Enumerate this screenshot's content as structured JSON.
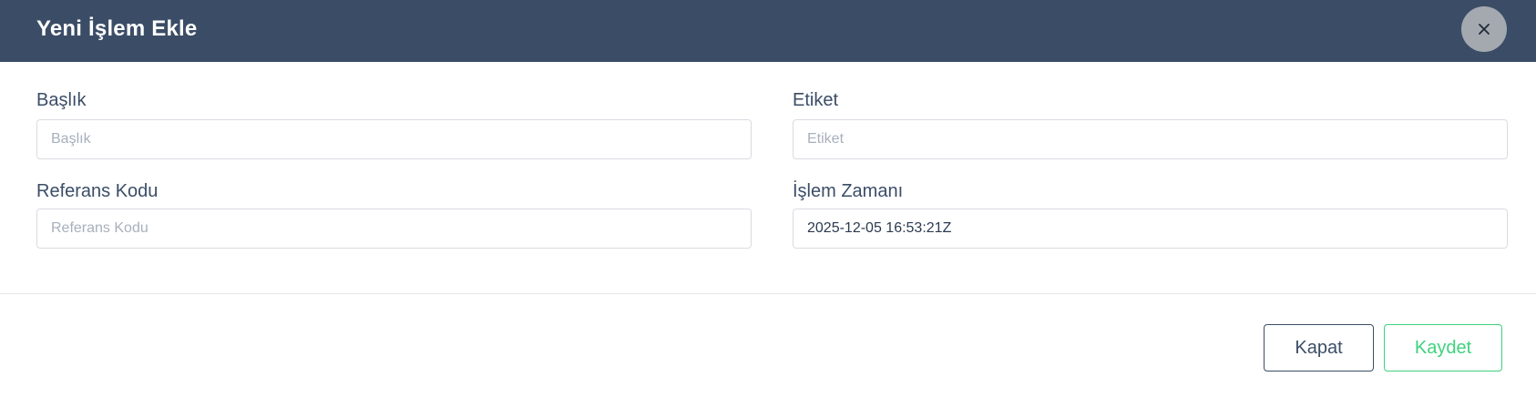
{
  "modal": {
    "title": "Yeni İşlem Ekle",
    "close_icon": "close-icon"
  },
  "form": {
    "title_field": {
      "label": "Başlık",
      "placeholder": "Başlık",
      "value": ""
    },
    "tag_field": {
      "label": "Etiket",
      "placeholder": "Etiket",
      "value": ""
    },
    "reference_field": {
      "label": "Referans Kodu",
      "placeholder": "Referans Kodu",
      "value": ""
    },
    "time_field": {
      "label": "İşlem Zamanı",
      "placeholder": "",
      "value": "2025-12-05 16:53:21Z"
    }
  },
  "footer": {
    "cancel_label": "Kapat",
    "save_label": "Kaydet"
  },
  "colors": {
    "header_bg": "#3b4d66",
    "close_bg": "#a4a9b0",
    "label_text": "#3b4d66",
    "save_accent": "#3fd17e"
  }
}
